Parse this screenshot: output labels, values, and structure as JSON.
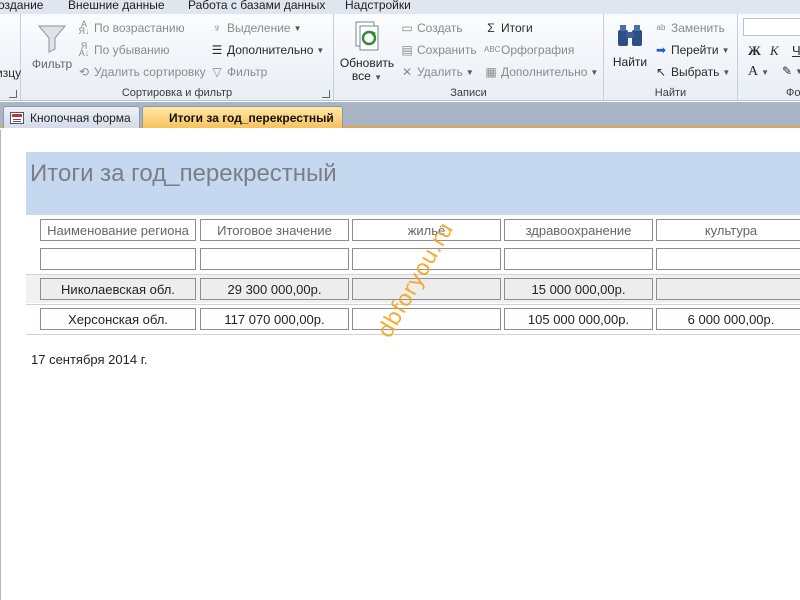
{
  "menu_tabs": [
    "оздание",
    "Внешние данные",
    "Работа с базами данных",
    "Надстройки"
  ],
  "ribbon": {
    "sort_filter": {
      "filter_label": "Фильтр",
      "ascending": "По возрастанию",
      "descending": "По убыванию",
      "remove_sort": "Удалить сортировку",
      "selection": "Выделение",
      "advanced": "Дополнительно",
      "toggle_filter": "Фильтр",
      "group_label": "Сортировка и фильтр"
    },
    "records": {
      "refresh_line1": "Обновить",
      "refresh_line2": "все",
      "new": "Создать",
      "save": "Сохранить",
      "delete": "Удалить",
      "totals": "Итоги",
      "spelling": "Орфография",
      "more": "Дополнительно",
      "group_label": "Записи"
    },
    "find": {
      "find_label": "Найти",
      "replace": "Заменить",
      "goto": "Перейти",
      "select": "Выбрать",
      "group_label": "Найти"
    },
    "left_partial": "изцу",
    "format_partial": "Фо"
  },
  "doc_tabs": [
    {
      "label": "Кнопочная форма",
      "active": false
    },
    {
      "label": "Итоги за год_перекрестный",
      "active": true
    }
  ],
  "report": {
    "title": "Итоги за год_перекрестный",
    "columns": [
      "Наименование региона",
      "Итоговое значение",
      "жильё",
      "здравоохранение",
      "культура"
    ],
    "rows": [
      [
        "Николаевская обл.",
        "29 300 000,00р.",
        "",
        "15 000 000,00р.",
        ""
      ],
      [
        "Херсонская обл.",
        "117 070 000,00р.",
        "",
        "105 000 000,00р.",
        "6 000 000,00р."
      ]
    ],
    "date": "17 сентября 2014 г.",
    "watermark": "dbforyou.ru"
  },
  "colors": {
    "header_band": "#c6d8ef",
    "active_tab": "#f8c25d",
    "watermark": "#f2a51f"
  }
}
